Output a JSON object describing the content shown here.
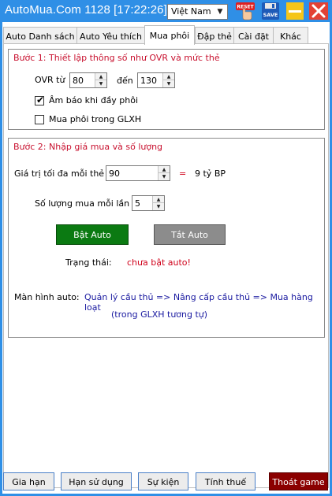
{
  "window": {
    "title": "AutoMua.Com 1128 [17:22:26]",
    "language": "Việt Nam",
    "reset_label": "RESET",
    "save_label": "SAVE"
  },
  "tabs": [
    {
      "label": "Auto Danh sách"
    },
    {
      "label": "Auto Yêu thích"
    },
    {
      "label": "Mua phôi"
    },
    {
      "label": "Đập thẻ"
    },
    {
      "label": "Cài đặt"
    },
    {
      "label": "Khác"
    }
  ],
  "step1": {
    "title": "Bước 1: Thiết lập thông số như OVR và mức thẻ",
    "ovr_from_label": "OVR từ",
    "ovr_from": "80",
    "ovr_to_label": "đến",
    "ovr_to": "130",
    "alert_label": "Âm báo khi đầy phôi",
    "alert_checked": true,
    "glxh_label": "Mua phôi trong GLXH",
    "glxh_checked": false
  },
  "step2": {
    "title": "Bước 2: Nhập giá mua và số lượng",
    "max_price_label": "Giá trị tối đa mỗi thẻ",
    "max_price": "90",
    "equals": "=",
    "bp_text": "9 tỷ BP",
    "qty_label": "Số lượng mua mỗi lần",
    "qty": "5",
    "on_button": "Bật Auto",
    "off_button": "Tắt Auto",
    "status_label": "Trạng thái:",
    "status_value": "chưa bật auto!",
    "screen_label": "Màn hình auto:",
    "screen_path": "Quản lý cầu thủ => Nâng cấp cầu thủ => Mua hàng loạt",
    "screen_note": "(trong GLXH tương tự)"
  },
  "footer": {
    "renew": "Gia hạn",
    "expiry": "Hạn sử dụng",
    "events": "Sự kiện",
    "tax": "Tính thuế",
    "exit": "Thoát game"
  }
}
